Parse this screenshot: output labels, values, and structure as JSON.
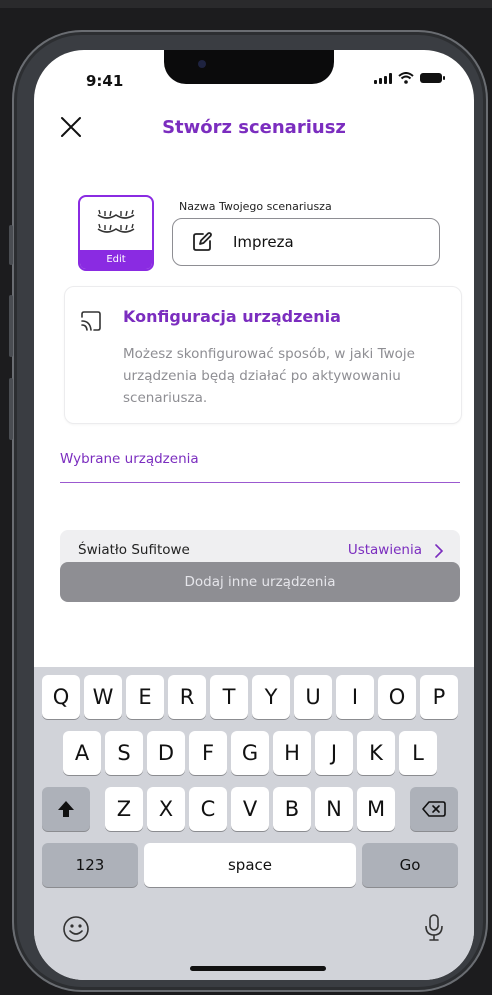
{
  "status": {
    "time": "9:41"
  },
  "header": {
    "title": "Stwórz scenariusz"
  },
  "scenario": {
    "edit_label": "Edit",
    "name_label": "Nazwa Twojego scenariusza",
    "name_value": "Impreza"
  },
  "config": {
    "title": "Konfiguracja urządzenia",
    "description": "Możesz skonfigurować sposób, w jaki Twoje urządzenia będą działać po aktywowaniu scenariusza."
  },
  "devices": {
    "heading": "Wybrane urządzenia",
    "items": [
      {
        "name": "Światło Sufitowe",
        "action": "Ustawienia"
      }
    ],
    "add_button": "Dodaj inne urządzenia"
  },
  "keyboard": {
    "row1": [
      "Q",
      "W",
      "E",
      "R",
      "T",
      "Y",
      "U",
      "I",
      "O",
      "P"
    ],
    "row2": [
      "A",
      "S",
      "D",
      "F",
      "G",
      "H",
      "J",
      "K",
      "L"
    ],
    "row3": [
      "Z",
      "X",
      "C",
      "V",
      "B",
      "N",
      "M"
    ],
    "numbers": "123",
    "space": "space",
    "go": "Go"
  },
  "colors": {
    "accent": "#7b2dbf",
    "edit_bg": "#8a2be2",
    "button_gray": "#8e8e93"
  }
}
